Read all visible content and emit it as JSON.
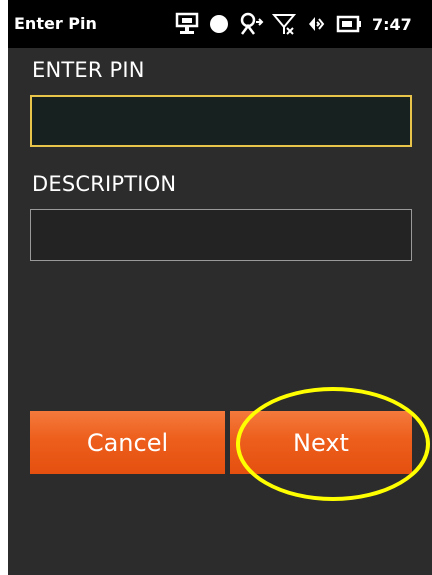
{
  "status_bar": {
    "title": "Enter Pin",
    "time": "7:47",
    "icons": [
      "screen-icon",
      "dot-icon",
      "connectivity-icon",
      "no-signal-icon",
      "volume-icon",
      "battery-icon"
    ]
  },
  "form": {
    "pin_label": "ENTER PIN",
    "pin_value": "",
    "description_label": "DESCRIPTION",
    "description_value": ""
  },
  "buttons": {
    "cancel_label": "Cancel",
    "next_label": "Next"
  },
  "colors": {
    "background": "#2c2c2c",
    "accent_button": "#ed5e1c",
    "focus_border": "#e8c44a",
    "highlight_annotation": "#ffff00"
  }
}
